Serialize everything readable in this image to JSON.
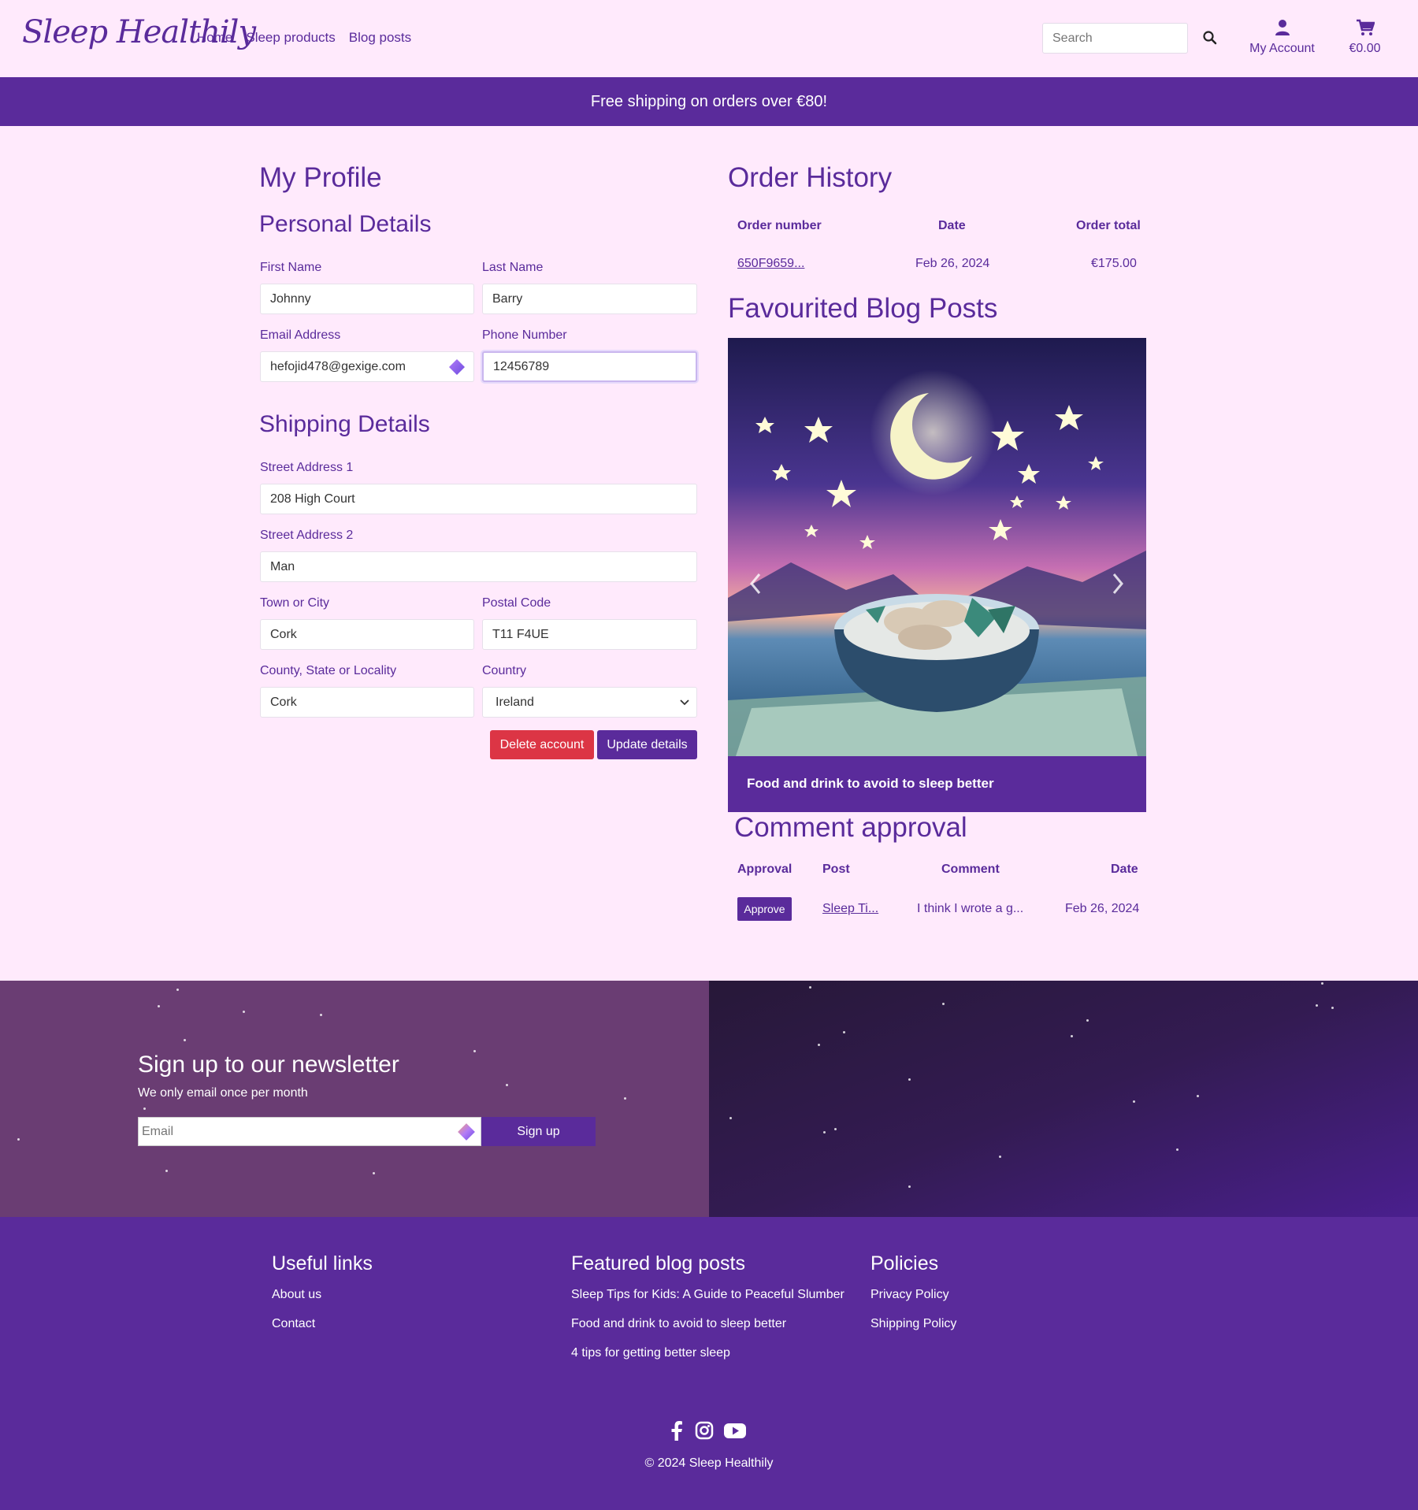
{
  "header": {
    "logo": "Sleep Healthily",
    "nav": [
      "Home",
      "Sleep products",
      "Blog posts"
    ],
    "search_placeholder": "Search",
    "account_label": "My Account",
    "cart_total": "€0.00"
  },
  "banner": "Free shipping on orders over €80!",
  "profile": {
    "title": "My Profile",
    "personal_title": "Personal Details",
    "first_name_label": "First Name",
    "first_name": "Johnny",
    "last_name_label": "Last Name",
    "last_name": "Barry",
    "email_label": "Email Address",
    "email": "hefojid478@gexige.com",
    "phone_label": "Phone Number",
    "phone": "12456789",
    "shipping_title": "Shipping Details",
    "street1_label": "Street Address 1",
    "street1": "208 High Court",
    "street2_label": "Street Address 2",
    "street2": "Man",
    "town_label": "Town or City",
    "town": "Cork",
    "postal_label": "Postal Code",
    "postal": "T11 F4UE",
    "county_label": "County, State or Locality",
    "county": "Cork",
    "country_label": "Country",
    "country": "Ireland",
    "delete_label": "Delete account",
    "update_label": "Update details"
  },
  "orders": {
    "title": "Order History",
    "headers": [
      "Order number",
      "Date",
      "Order total"
    ],
    "rows": [
      {
        "number": "650F9659...",
        "date": "Feb 26, 2024",
        "total": "€175.00"
      }
    ]
  },
  "favourites": {
    "title": "Favourited Blog Posts",
    "caption": "Food and drink to avoid to sleep better"
  },
  "comments": {
    "title": "Comment approval",
    "headers": [
      "Approval",
      "Post",
      "Comment",
      "Date"
    ],
    "rows": [
      {
        "approve_label": "Approve",
        "post": "Sleep Ti...",
        "comment": "I think I wrote a g...",
        "date": "Feb 26, 2024"
      }
    ]
  },
  "newsletter": {
    "title": "Sign up to our newsletter",
    "subtitle": "We only email once per month",
    "email_placeholder": "Email",
    "signup_label": "Sign up"
  },
  "footer": {
    "useful_title": "Useful links",
    "useful_links": [
      "About us",
      "Contact"
    ],
    "blog_title": "Featured blog posts",
    "blog_links": [
      "Sleep Tips for Kids: A Guide to Peaceful Slumber",
      "Food and drink to avoid to sleep better",
      "4 tips for getting better sleep"
    ],
    "policies_title": "Policies",
    "policy_links": [
      "Privacy Policy",
      "Shipping Policy"
    ],
    "social_icons": [
      "facebook-icon",
      "instagram-icon",
      "youtube-icon"
    ],
    "copyright": "© 2024 Sleep Healthily"
  },
  "colors": {
    "brand": "#5a2b9b",
    "background": "#ffeafc",
    "danger": "#dc3545"
  }
}
